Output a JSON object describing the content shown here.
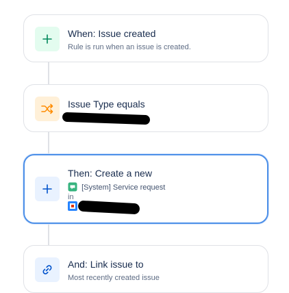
{
  "rules": [
    {
      "title": "When: Issue created",
      "subtitle": "Rule is run when an issue is created.",
      "icon": "plus-icon",
      "icon_color": "#00875a",
      "icon_bg": "#e3fcef"
    },
    {
      "title": "Issue Type equals",
      "subtitle": "",
      "icon": "shuffle-icon",
      "icon_color": "#ff8b00",
      "icon_bg": "#fff0d8"
    },
    {
      "title": "Then: Create a new",
      "issue_type": "[System] Service request",
      "in_label": "in",
      "icon": "plus-icon",
      "icon_color": "#0052cc",
      "icon_bg": "#e9f2ff"
    },
    {
      "title": "And: Link issue to",
      "subtitle": "Most recently created issue",
      "icon": "link-icon",
      "icon_color": "#0052cc",
      "icon_bg": "#e9f2ff"
    }
  ]
}
